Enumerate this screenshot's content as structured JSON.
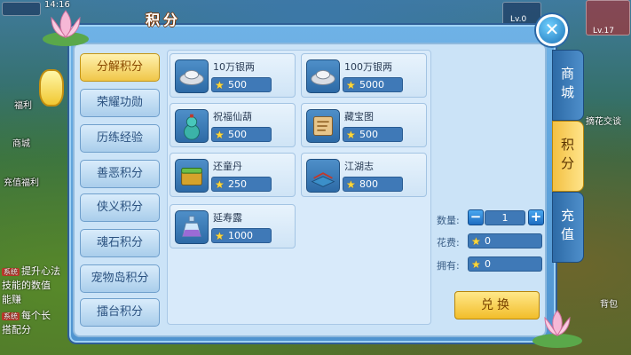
{
  "hud": {
    "clock": "14:16",
    "level_left": "Lv.0",
    "level_right": "Lv.17",
    "left_labels": [
      "福利",
      "商城",
      "充值福利"
    ],
    "chat": [
      {
        "tag": "系统",
        "text": "提升心法",
        "hl": ""
      },
      {
        "tag": "",
        "text": "技能的数值",
        "hl": ""
      },
      {
        "tag": "",
        "text": "能赚",
        "hl": ""
      },
      {
        "tag": "系统",
        "text": "每个长",
        "hl": ""
      },
      {
        "tag": "",
        "text": "搭配分",
        "hl": ""
      }
    ],
    "right_text": "摘花交谈",
    "bottom_right": "背包"
  },
  "panel": {
    "title": "积分",
    "close_icon": "close-icon"
  },
  "categories": [
    {
      "label": "分解积分",
      "active": true
    },
    {
      "label": "荣耀功勋",
      "active": false
    },
    {
      "label": "历练经验",
      "active": false
    },
    {
      "label": "善恶积分",
      "active": false
    },
    {
      "label": "侠义积分",
      "active": false
    },
    {
      "label": "魂石积分",
      "active": false
    },
    {
      "label": "宠物岛积分",
      "active": false
    },
    {
      "label": "擂台积分",
      "active": false
    }
  ],
  "items": [
    {
      "name": "10万银两",
      "price": "500",
      "icon": "silver-ingot-icon"
    },
    {
      "name": "100万银两",
      "price": "5000",
      "icon": "silver-ingot-icon"
    },
    {
      "name": "祝福仙葫",
      "price": "500",
      "icon": "gourd-icon"
    },
    {
      "name": "藏宝图",
      "price": "500",
      "icon": "treasure-map-icon"
    },
    {
      "name": "还童丹",
      "price": "250",
      "icon": "pill-box-icon"
    },
    {
      "name": "江湖志",
      "price": "800",
      "icon": "book-icon"
    },
    {
      "name": "延寿露",
      "price": "1000",
      "icon": "potion-bottle-icon"
    }
  ],
  "exchange": {
    "qty_label": "数量:",
    "qty_value": "1",
    "cost_label": "花费:",
    "cost_value": "0",
    "own_label": "拥有:",
    "own_value": "0",
    "button": "兑换"
  },
  "side_tabs": [
    {
      "label": "商城",
      "active": false
    },
    {
      "label": "积分",
      "active": true
    },
    {
      "label": "充值",
      "active": false
    }
  ],
  "colors": {
    "accent": "#f0c648",
    "panel": "#4f94d0",
    "price_box": "#3f79b7"
  }
}
